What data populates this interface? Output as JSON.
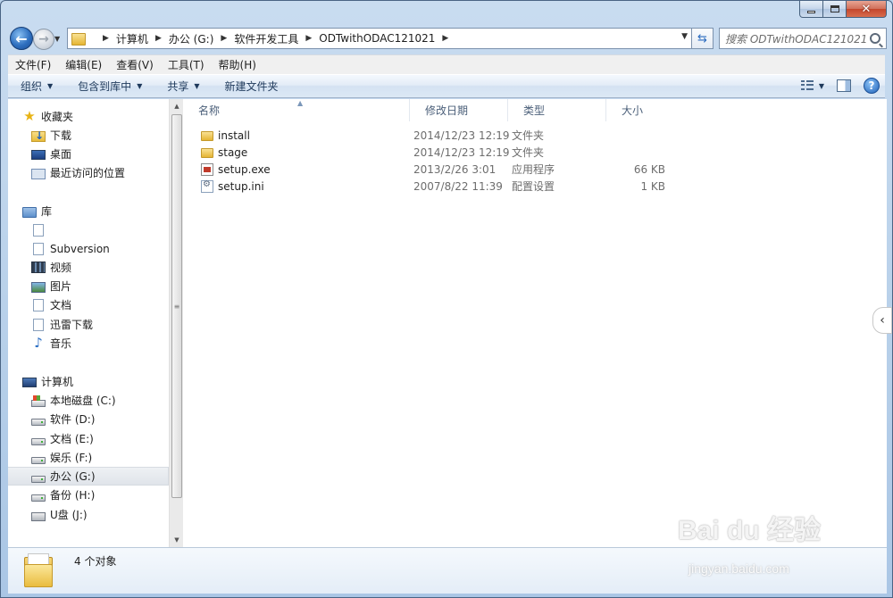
{
  "window": {
    "controls": {
      "minimize_icon": "minimize-icon",
      "maximize_icon": "maximize-icon",
      "close_icon": "close-icon"
    }
  },
  "nav": {
    "back_icon": "back-arrow-icon",
    "forward_icon": "forward-arrow-icon",
    "breadcrumbs": [
      "计算机",
      "办公 (G:)",
      "软件开发工具",
      "ODTwithODAC121021"
    ],
    "search_placeholder": "搜索 ODTwithODAC121021"
  },
  "menu": [
    "文件(F)",
    "编辑(E)",
    "查看(V)",
    "工具(T)",
    "帮助(H)"
  ],
  "commands": [
    "组织",
    "包含到库中",
    "共享",
    "新建文件夹"
  ],
  "sidebar": {
    "favorites": {
      "label": "收藏夹",
      "items": [
        "下载",
        "桌面",
        "最近访问的位置"
      ]
    },
    "libraries": {
      "label": "库",
      "items": [
        "",
        "Subversion",
        "视频",
        "图片",
        "文档",
        "迅雷下载",
        "音乐"
      ]
    },
    "computer": {
      "label": "计算机",
      "items": [
        "本地磁盘 (C:)",
        "软件 (D:)",
        "文档 (E:)",
        "娱乐 (F:)",
        "办公 (G:)",
        "备份 (H:)",
        "U盘 (J:)"
      ]
    },
    "selected": "办公 (G:)"
  },
  "file_list": {
    "columns": [
      "名称",
      "修改日期",
      "类型",
      "大小"
    ],
    "rows": [
      {
        "name": "install",
        "date": "2014/12/23 12:19",
        "type": "文件夹",
        "size": "",
        "icon": "folder-icon"
      },
      {
        "name": "stage",
        "date": "2014/12/23 12:19",
        "type": "文件夹",
        "size": "",
        "icon": "folder-icon"
      },
      {
        "name": "setup.exe",
        "date": "2013/2/26 3:01",
        "type": "应用程序",
        "size": "66 KB",
        "icon": "exe-icon"
      },
      {
        "name": "setup.ini",
        "date": "2007/8/22 11:39",
        "type": "配置设置",
        "size": "1 KB",
        "icon": "ini-icon"
      }
    ]
  },
  "details": {
    "count": "4 个对象"
  },
  "watermark": {
    "brand": "Bai du 经验",
    "url": "jingyan.baidu.com"
  }
}
